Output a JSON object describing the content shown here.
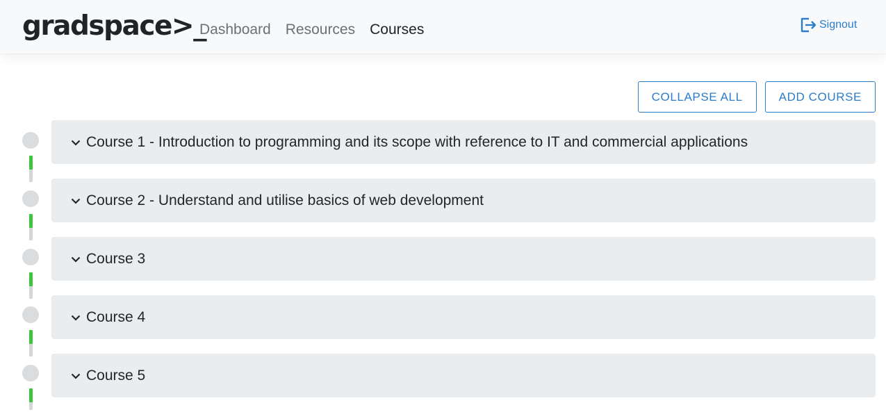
{
  "header": {
    "logo": "gradspace>_",
    "nav": [
      {
        "label": "Dashboard",
        "active": false
      },
      {
        "label": "Resources",
        "active": false
      },
      {
        "label": "Courses",
        "active": true
      }
    ],
    "signout_label": "Signout",
    "accent_color": "#2c7cc9"
  },
  "toolbar": {
    "collapse_all_label": "COLLAPSE ALL",
    "add_course_label": "ADD COURSE"
  },
  "courses": [
    {
      "title": "Course 1 - Introduction to programming and its scope with reference to IT and commercial applications"
    },
    {
      "title": "Course 2 - Understand and utilise basics of web development"
    },
    {
      "title": "Course 3"
    },
    {
      "title": "Course 4"
    },
    {
      "title": "Course 5"
    }
  ]
}
